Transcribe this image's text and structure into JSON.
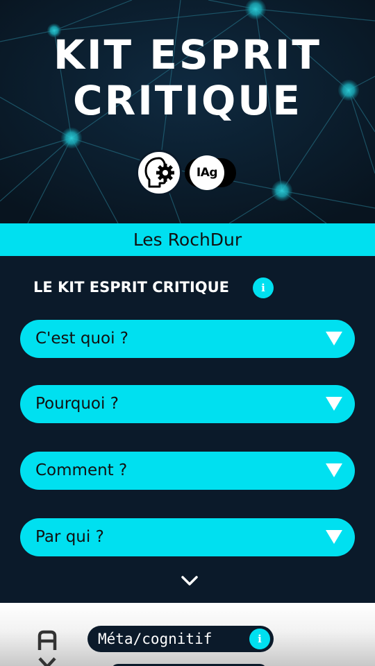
{
  "hero": {
    "title_line1": "KIT ESPRIT",
    "title_line2": "CRITIQUE",
    "logo_icon": "head-gear-icon",
    "toggle_label": "IAg"
  },
  "group": {
    "name": "Les RochDur"
  },
  "section": {
    "heading": "LE KIT ESPRIT CRITIQUE",
    "info_glyph": "i"
  },
  "accordions": [
    {
      "label": "C'est quoi ?",
      "icon": "caret-down-icon"
    },
    {
      "label": "Pourquoi ?",
      "icon": "caret-down-icon"
    },
    {
      "label": "Comment ?",
      "icon": "caret-down-icon"
    },
    {
      "label": "Par qui ?",
      "icon": "caret-down-icon"
    }
  ],
  "more": {
    "icon": "chevron-down-icon"
  },
  "bottom": {
    "text_size_icon": "text-size-icon",
    "category_label": "Méta/cognitif",
    "info_glyph": "i"
  },
  "colors": {
    "navy": "#0b1a2a",
    "cyan": "#00e0f0",
    "white": "#ffffff"
  }
}
